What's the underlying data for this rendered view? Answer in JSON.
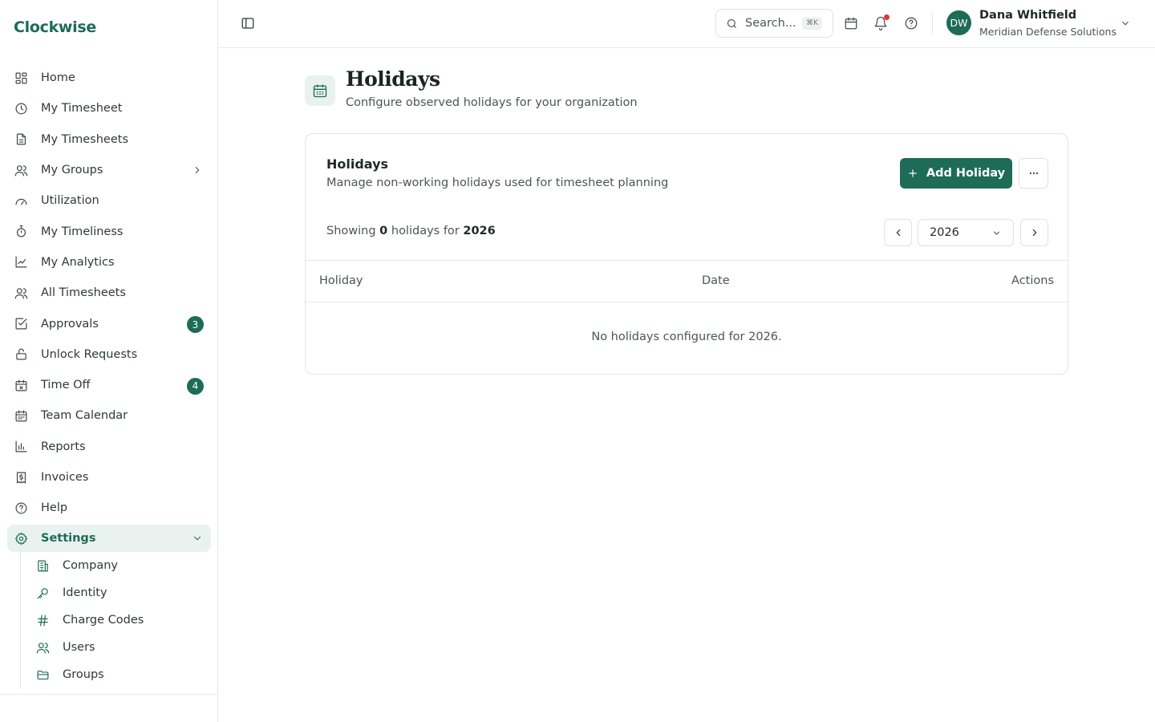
{
  "app": {
    "brand": "Clockwise"
  },
  "sidebar": {
    "items": [
      {
        "label": "Home",
        "icon": "dashboard-icon"
      },
      {
        "label": "My Timesheet",
        "icon": "clock-icon"
      },
      {
        "label": "My Timesheets",
        "icon": "document-icon"
      },
      {
        "label": "My Groups",
        "icon": "users-icon"
      },
      {
        "label": "Utilization",
        "icon": "gauge-icon"
      },
      {
        "label": "My Timeliness",
        "icon": "stopwatch-icon"
      },
      {
        "label": "My Analytics",
        "icon": "line-chart-icon"
      },
      {
        "label": "All Timesheets",
        "icon": "users-icon"
      },
      {
        "label": "Approvals",
        "icon": "checkbox-icon",
        "badge": "3"
      },
      {
        "label": "Unlock Requests",
        "icon": "unlock-icon"
      },
      {
        "label": "Time Off",
        "icon": "calendar-x-icon",
        "badge": "4"
      },
      {
        "label": "Team Calendar",
        "icon": "calendar-icon"
      },
      {
        "label": "Reports",
        "icon": "bar-chart-icon"
      },
      {
        "label": "Invoices",
        "icon": "invoice-icon"
      },
      {
        "label": "Help",
        "icon": "help-icon"
      }
    ],
    "settings": {
      "label": "Settings",
      "children": [
        {
          "label": "Company",
          "icon": "building-icon"
        },
        {
          "label": "Identity",
          "icon": "key-icon"
        },
        {
          "label": "Charge Codes",
          "icon": "hash-icon"
        },
        {
          "label": "Users",
          "icon": "users-icon"
        },
        {
          "label": "Groups",
          "icon": "folder-icon"
        }
      ]
    }
  },
  "header": {
    "search_placeholder": "Search...",
    "search_shortcut": "⌘K",
    "user": {
      "initials": "DW",
      "name": "Dana Whitfield",
      "org": "Meridian Defense Solutions"
    }
  },
  "page": {
    "title": "Holidays",
    "subtitle": "Configure observed holidays for your organization"
  },
  "card": {
    "title": "Holidays",
    "subtitle": "Manage non-working holidays used for timesheet planning",
    "add_label": "Add Holiday",
    "showing_prefix": "Showing",
    "count": "0",
    "showing_mid": "holidays for",
    "year": "2026",
    "selected_year": "2026",
    "columns": [
      "Holiday",
      "Date",
      "Actions"
    ],
    "empty_message": "No holidays configured for 2026."
  },
  "colors": {
    "accent": "#1e6b58",
    "notification": "#e5312f",
    "accent_light": "#e9f2ef"
  }
}
